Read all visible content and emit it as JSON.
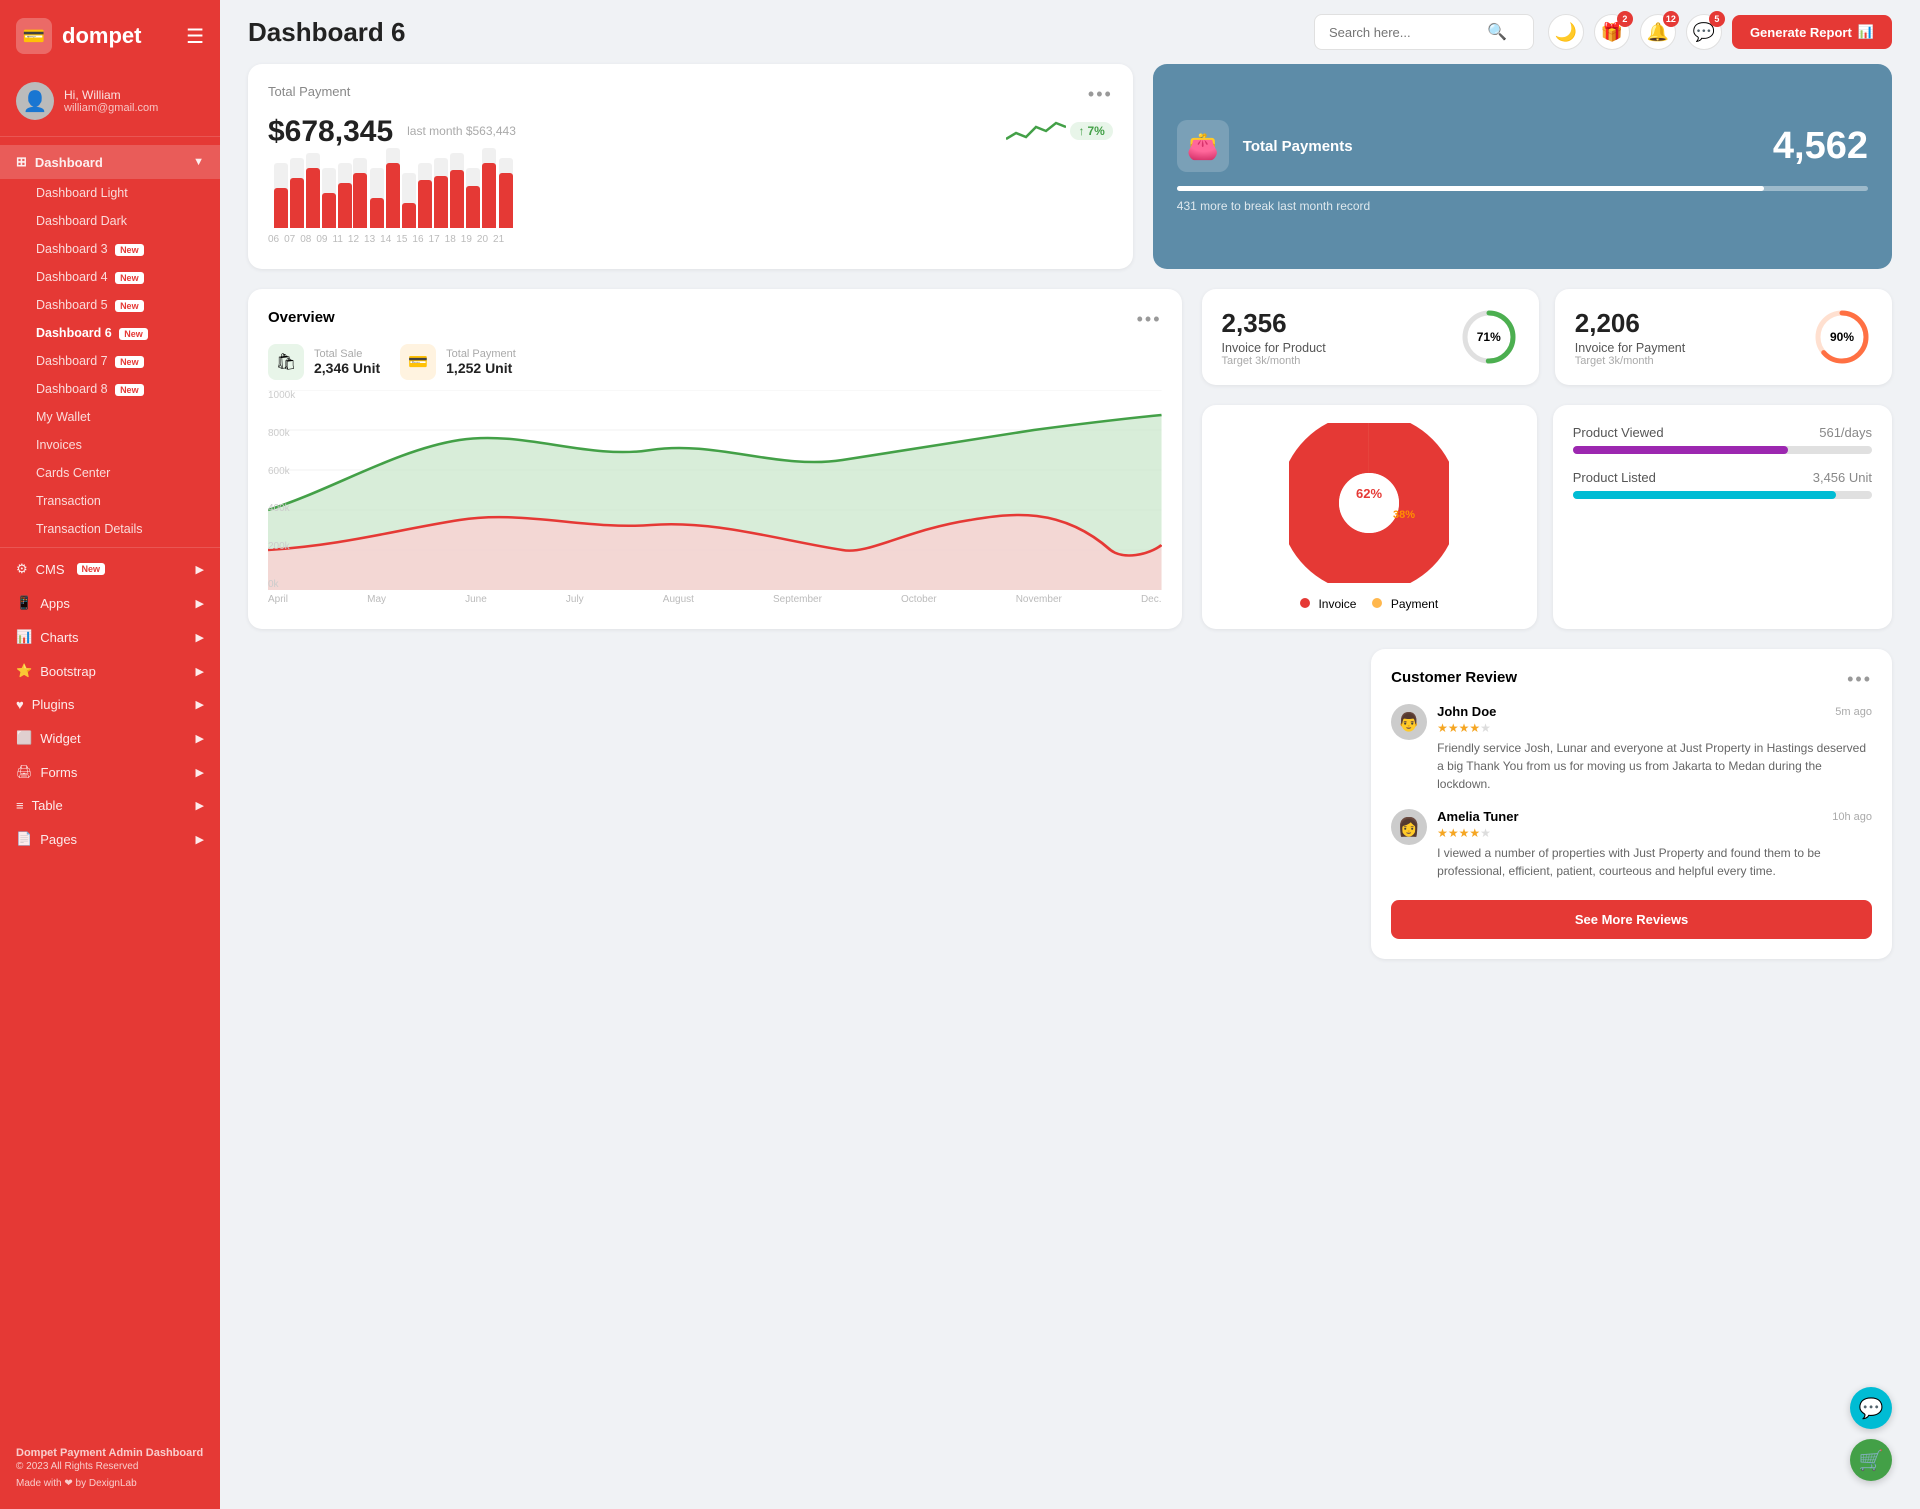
{
  "sidebar": {
    "logo": "dompet",
    "logo_icon": "💳",
    "user": {
      "hi": "Hi, William",
      "name": "William",
      "email": "william@gmail.com",
      "avatar": "👤"
    },
    "nav": [
      {
        "id": "dashboard",
        "label": "Dashboard",
        "icon": "⊞",
        "hasDropdown": true,
        "active": true
      },
      {
        "id": "dashboard-light",
        "label": "Dashboard Light",
        "isSubItem": true
      },
      {
        "id": "dashboard-dark",
        "label": "Dashboard Dark",
        "isSubItem": true
      },
      {
        "id": "dashboard-3",
        "label": "Dashboard 3",
        "isSubItem": true,
        "badge": "New"
      },
      {
        "id": "dashboard-4",
        "label": "Dashboard 4",
        "isSubItem": true,
        "badge": "New"
      },
      {
        "id": "dashboard-5",
        "label": "Dashboard 5",
        "isSubItem": true,
        "badge": "New"
      },
      {
        "id": "dashboard-6",
        "label": "Dashboard 6",
        "isSubItem": true,
        "badge": "New",
        "active": true
      },
      {
        "id": "dashboard-7",
        "label": "Dashboard 7",
        "isSubItem": true,
        "badge": "New"
      },
      {
        "id": "dashboard-8",
        "label": "Dashboard 8",
        "isSubItem": true,
        "badge": "New"
      },
      {
        "id": "my-wallet",
        "label": "My Wallet",
        "isSubItem": true
      },
      {
        "id": "invoices",
        "label": "Invoices",
        "isSubItem": true
      },
      {
        "id": "cards-center",
        "label": "Cards Center",
        "isSubItem": true
      },
      {
        "id": "transaction",
        "label": "Transaction",
        "isSubItem": true
      },
      {
        "id": "transaction-details",
        "label": "Transaction Details",
        "isSubItem": true
      },
      {
        "id": "cms",
        "label": "CMS",
        "icon": "⚙",
        "badge": "New",
        "hasDropdown": true
      },
      {
        "id": "apps",
        "label": "Apps",
        "icon": "📱",
        "hasDropdown": true
      },
      {
        "id": "charts",
        "label": "Charts",
        "icon": "📊",
        "hasDropdown": true
      },
      {
        "id": "bootstrap",
        "label": "Bootstrap",
        "icon": "⭐",
        "hasDropdown": true
      },
      {
        "id": "plugins",
        "label": "Plugins",
        "icon": "❤",
        "hasDropdown": true
      },
      {
        "id": "widget",
        "label": "Widget",
        "icon": "🔲",
        "hasDropdown": true
      },
      {
        "id": "forms",
        "label": "Forms",
        "icon": "🖨",
        "hasDropdown": true
      },
      {
        "id": "table",
        "label": "Table",
        "icon": "≡",
        "hasDropdown": true
      },
      {
        "id": "pages",
        "label": "Pages",
        "icon": "📄",
        "hasDropdown": true
      }
    ],
    "footer": {
      "app_name": "Dompet Payment Admin Dashboard",
      "copy": "© 2023 All Rights Reserved",
      "made": "Made with ❤ by DexignLab"
    }
  },
  "topbar": {
    "title": "Dashboard 6",
    "search_placeholder": "Search here...",
    "icons": {
      "moon": "🌙",
      "gift_badge": "2",
      "bell_badge": "12",
      "chat_badge": "5"
    },
    "generate_btn": "Generate Report"
  },
  "total_payment": {
    "title": "Total Payment",
    "amount": "$678,345",
    "last_month_label": "last month $563,443",
    "trend": "7%",
    "bars": [
      {
        "label": "06",
        "bg": 65,
        "red": 40
      },
      {
        "label": "07",
        "bg": 70,
        "red": 50
      },
      {
        "label": "08",
        "bg": 75,
        "red": 60
      },
      {
        "label": "09",
        "bg": 60,
        "red": 35
      },
      {
        "label": "11",
        "bg": 65,
        "red": 45
      },
      {
        "label": "12",
        "bg": 70,
        "red": 55
      },
      {
        "label": "13",
        "bg": 60,
        "red": 30
      },
      {
        "label": "14",
        "bg": 80,
        "red": 65
      },
      {
        "label": "15",
        "bg": 55,
        "red": 25
      },
      {
        "label": "16",
        "bg": 65,
        "red": 48
      },
      {
        "label": "17",
        "bg": 70,
        "red": 52
      },
      {
        "label": "18",
        "bg": 75,
        "red": 58
      },
      {
        "label": "19",
        "bg": 60,
        "red": 42
      },
      {
        "label": "20",
        "bg": 80,
        "red": 65
      },
      {
        "label": "21",
        "bg": 70,
        "red": 55
      }
    ]
  },
  "total_payments_blue": {
    "label": "Total Payments",
    "sub": "431 more to break last month record",
    "number": "4,562",
    "icon": "👛",
    "bar_fill": 85
  },
  "invoice_product": {
    "number": "2,356",
    "label": "Invoice for Product",
    "sub": "Target 3k/month",
    "percent": 71,
    "color": "#4caf50"
  },
  "invoice_payment": {
    "number": "2,206",
    "label": "Invoice for Payment",
    "sub": "Target 3k/month",
    "percent": 90,
    "color": "#ff7043"
  },
  "overview": {
    "title": "Overview",
    "total_sale_label": "Total Sale",
    "total_sale_value": "2,346 Unit",
    "total_payment_label": "Total Payment",
    "total_payment_value": "1,252 Unit",
    "months": [
      "April",
      "May",
      "June",
      "July",
      "August",
      "September",
      "October",
      "November",
      "Dec."
    ],
    "y_labels": [
      "1000k",
      "800k",
      "600k",
      "400k",
      "200k",
      "0k"
    ]
  },
  "pie": {
    "invoice_pct": 62,
    "payment_pct": 38,
    "invoice_color": "#e53935",
    "payment_color": "#ffb74d",
    "invoice_label": "Invoice",
    "payment_label": "Payment"
  },
  "customer_review": {
    "title": "Customer Review",
    "reviews": [
      {
        "name": "John Doe",
        "time": "5m ago",
        "rating": 4,
        "text": "Friendly service Josh, Lunar and everyone at Just Property in Hastings deserved a big Thank You from us for moving us from Jakarta to Medan during the lockdown.",
        "avatar": "👨"
      },
      {
        "name": "Amelia Tuner",
        "time": "10h ago",
        "rating": 4,
        "text": "I viewed a number of properties with Just Property and found them to be professional, efficient, patient, courteous and helpful every time.",
        "avatar": "👩"
      }
    ],
    "see_more": "See More Reviews"
  },
  "products": {
    "viewed_label": "Product Viewed",
    "viewed_val": "561/days",
    "viewed_color": "#9c27b0",
    "viewed_pct": 72,
    "listed_label": "Product Listed",
    "listed_val": "3,456 Unit",
    "listed_color": "#00bcd4",
    "listed_pct": 88
  },
  "float_btns": {
    "chat": "💬",
    "cart": "🛒"
  }
}
